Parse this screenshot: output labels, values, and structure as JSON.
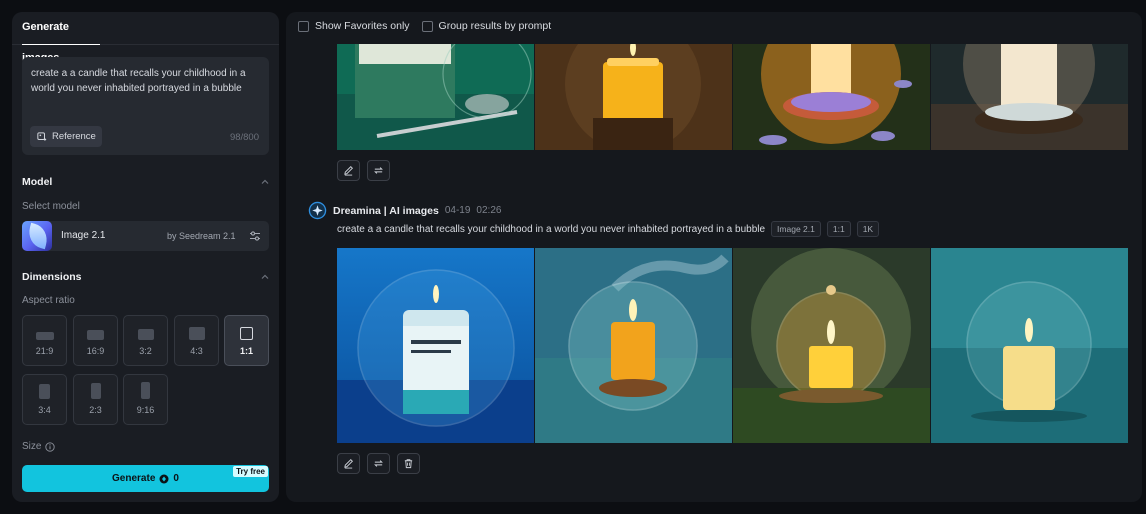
{
  "sidebar": {
    "tab_label": "Generate images",
    "prompt_text": "create a a candle that recalls your childhood in a world you never inhabited portrayed in a bubble",
    "reference_label": "Reference",
    "char_count": "98/800",
    "model_section": "Model",
    "select_model_label": "Select model",
    "model_name": "Image 2.1",
    "model_provider": "by Seedream 2.1",
    "dimensions_section": "Dimensions",
    "aspect_ratio_label": "Aspect ratio",
    "aspect_ratios": [
      "21:9",
      "16:9",
      "3:2",
      "4:3",
      "1:1",
      "3:4",
      "2:3",
      "9:16"
    ],
    "selected_ratio": "1:1",
    "size_label": "Size",
    "generate_label": "Generate",
    "generate_credits": "0",
    "try_free_label": "Try free"
  },
  "results": {
    "filter_favorites": "Show Favorites only",
    "filter_group": "Group results by prompt",
    "generation": {
      "source": "Dreamina | AI images",
      "date": "04-19",
      "time": "02:26",
      "prompt": "create a a candle that recalls your childhood in a world you never inhabited portrayed in a bubble",
      "tags": [
        "Image 2.1",
        "1:1",
        "1K"
      ]
    }
  },
  "colors": {
    "accent": "#12c4de",
    "panel": "#1a1d23",
    "background": "#0c0e12"
  },
  "icons": [
    "reference-icon",
    "chevron-up-icon",
    "settings-sliders-icon",
    "info-icon",
    "credit-icon",
    "edit-icon",
    "regenerate-icon",
    "trash-icon",
    "dreamina-logo-icon"
  ]
}
